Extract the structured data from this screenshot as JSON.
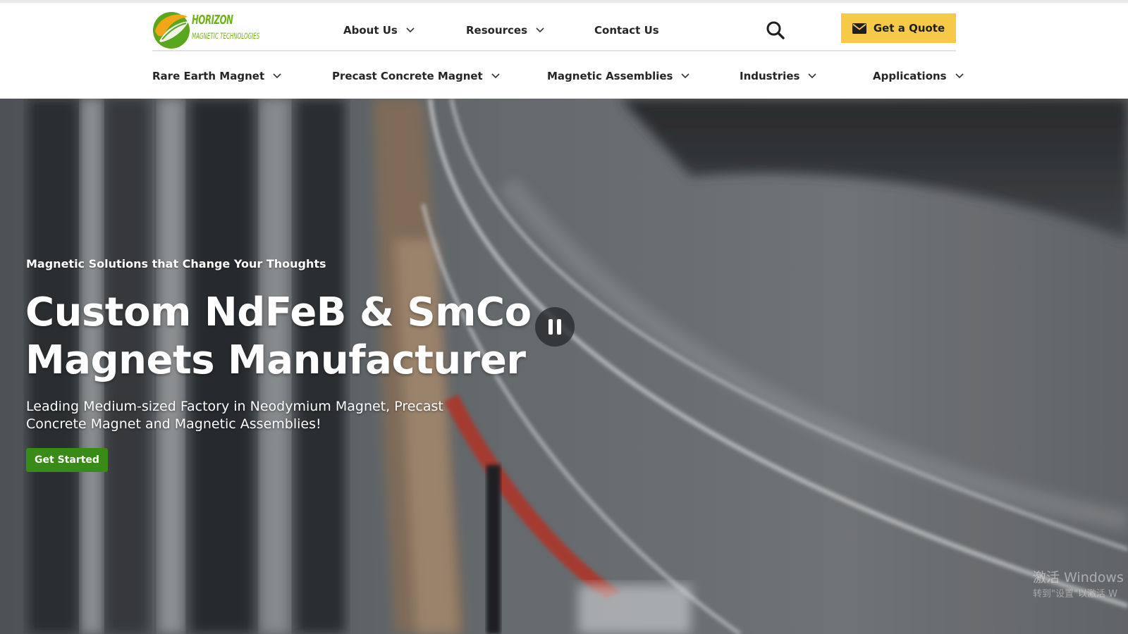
{
  "brand": {
    "name_line1": "HORIZON",
    "name_line2": "MAGNETIC TECHNOLOGIES",
    "green": "#6fb21a"
  },
  "top_nav": {
    "about": "About Us",
    "resources": "Resources",
    "contact": "Contact Us",
    "quote_button": "Get a Quote"
  },
  "main_nav": {
    "rare_earth": "Rare Earth Magnet",
    "precast": "Precast Concrete Magnet",
    "assemblies": "Magnetic Assemblies",
    "industries": "Industries",
    "applications": "Applications"
  },
  "hero": {
    "eyebrow": "Magnetic Solutions that Change Your Thoughts",
    "headline_line1": "Custom NdFeB & SmCo",
    "headline_line2": "Magnets Manufacturer",
    "subtitle": "Leading Medium-sized Factory in Neodymium Magnet, Precast Concrete Magnet and Magnetic Assemblies!",
    "cta": "Get Started",
    "video_state": "playing"
  },
  "os_watermark": {
    "line1": "激活 Windows",
    "line2": "转到\"设置\"以激活 W"
  },
  "colors": {
    "quote_yellow": "#f7c948",
    "cta_green": "#3a8a17",
    "nav_text": "#262626"
  },
  "icons": [
    "search-icon",
    "mail-icon",
    "chevron-down-icon",
    "pause-icon",
    "logo-leaf-icon"
  ]
}
